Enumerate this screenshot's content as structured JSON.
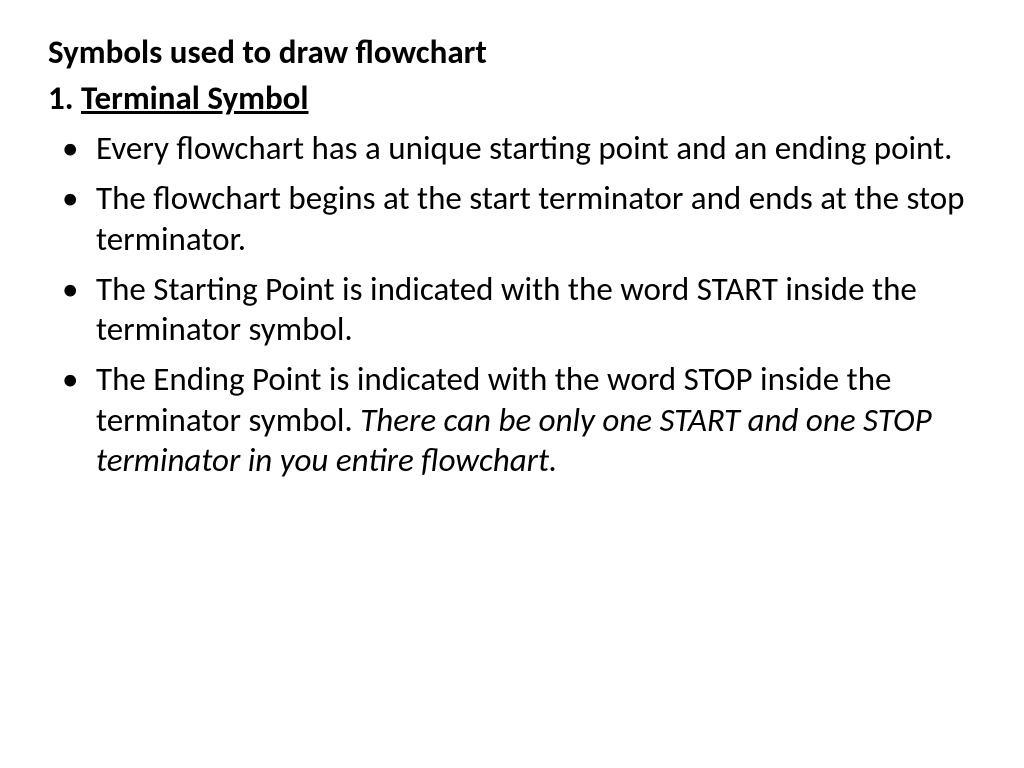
{
  "heading": "Symbols used to draw flowchart",
  "subheading": {
    "number": "1. ",
    "title": "Terminal Symbol"
  },
  "bullets": [
    {
      "text": "Every flowchart has a unique starting point and an ending point."
    },
    {
      "text": "The flowchart begins at the start terminator and ends at the stop terminator."
    },
    {
      "text": "The Starting Point is indicated with the word START inside the terminator symbol."
    },
    {
      "text": "The Ending Point is indicated with the word STOP inside the terminator symbol. ",
      "italic": "There can be only one START and one STOP terminator in you entire flowchart."
    }
  ]
}
